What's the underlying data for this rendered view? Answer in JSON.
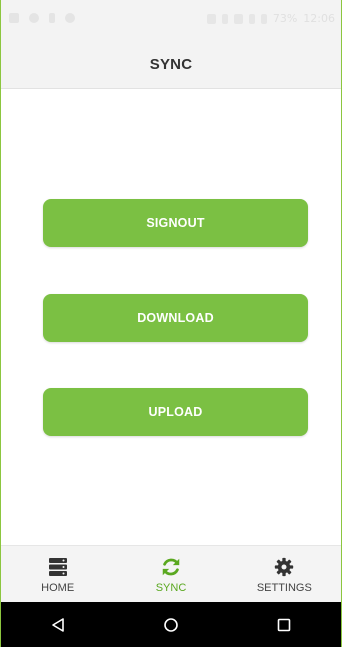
{
  "status_bar": {
    "battery": "73%",
    "time": "12:06"
  },
  "header": {
    "title": "SYNC"
  },
  "actions": {
    "signout_label": "SIGNOUT",
    "download_label": "DOWNLOAD",
    "upload_label": "UPLOAD"
  },
  "tabs": [
    {
      "label": "HOME",
      "icon": "server-icon",
      "active": false
    },
    {
      "label": "SYNC",
      "icon": "sync-icon",
      "active": true
    },
    {
      "label": "SETTINGS",
      "icon": "gear-icon",
      "active": false
    }
  ],
  "nav": {
    "back_icon": "back-triangle-icon",
    "home_icon": "home-circle-icon",
    "recents_icon": "recents-square-icon"
  },
  "colors": {
    "accent": "#7bc043",
    "active_tab": "#5aa820",
    "nav_bar": "#000000"
  }
}
